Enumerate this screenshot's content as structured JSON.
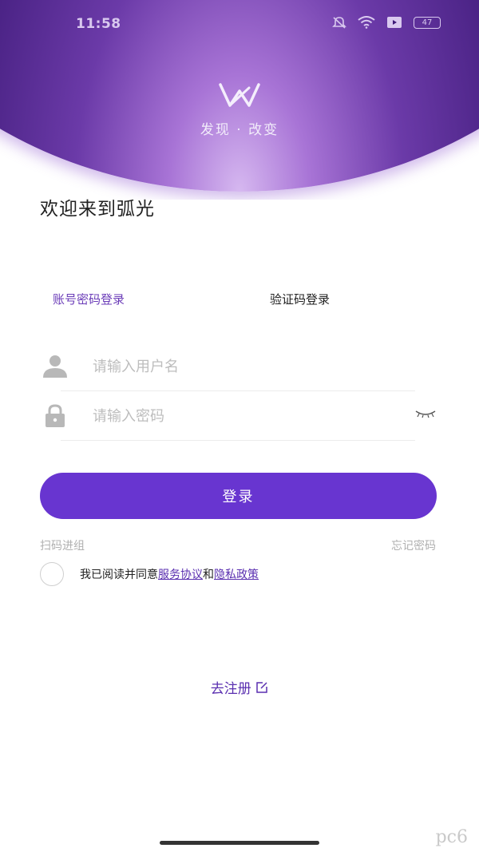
{
  "status_bar": {
    "time": "11:58",
    "battery": "47"
  },
  "header": {
    "slogan": "发现 · 改变",
    "logo_icon": "brand-w-logo"
  },
  "welcome": "欢迎来到弧光",
  "tabs": {
    "account": "账号密码登录",
    "code": "验证码登录"
  },
  "form": {
    "username_placeholder": "请输入用户名",
    "password_placeholder": "请输入密码"
  },
  "login_button": "登录",
  "links": {
    "scan": "扫码进组",
    "forgot": "忘记密码"
  },
  "agreement": {
    "prefix": "我已阅读并同意",
    "service": "服务协议",
    "and": "和",
    "privacy": "隐私政策"
  },
  "register": "去注册",
  "watermark": "pc6",
  "colors": {
    "accent": "#6835d0",
    "link": "#5a2fb0",
    "header_dark": "#2a0f5a"
  }
}
